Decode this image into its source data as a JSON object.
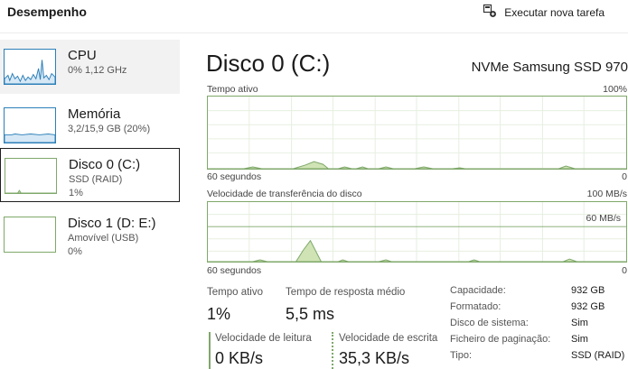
{
  "header": {
    "title": "Desempenho",
    "new_task_label": "Executar nova tarefa"
  },
  "sidebar": {
    "items": [
      {
        "name": "CPU",
        "line1": "0%  1,12 GHz",
        "line2": "",
        "state": "hover"
      },
      {
        "name": "Memória",
        "line1": "3,2/15,9 GB (20%)",
        "line2": "",
        "state": "normal"
      },
      {
        "name": "Disco 0 (C:)",
        "line1": "SSD (RAID)",
        "line2": "1%",
        "state": "selected"
      },
      {
        "name": "Disco 1 (D: E:)",
        "line1": "Amovível (USB)",
        "line2": "0%",
        "state": "normal"
      }
    ]
  },
  "main": {
    "title": "Disco 0 (C:)",
    "device": "NVMe Samsung SSD 970",
    "graph1": {
      "label": "Tempo ativo",
      "max_label": "100%",
      "time_label": "60 segundos",
      "min_label": "0"
    },
    "graph2": {
      "label": "Velocidade de transferência do disco",
      "max_label": "100 MB/s",
      "scale_label": "60 MB/s",
      "time_label": "60 segundos",
      "min_label": "0"
    },
    "stats": {
      "active_time_label": "Tempo ativo",
      "active_time_value": "1%",
      "response_label": "Tempo de resposta médio",
      "response_value": "5,5 ms",
      "read_label": "Velocidade de leitura",
      "read_value": "0 KB/s",
      "write_label": "Velocidade de escrita",
      "write_value": "35,3 KB/s"
    },
    "properties": [
      {
        "key": "Capacidade:",
        "value": "932 GB"
      },
      {
        "key": "Formatado:",
        "value": "932 GB"
      },
      {
        "key": "Disco de sistema:",
        "value": "Sim"
      },
      {
        "key": "Ficheiro de paginação:",
        "value": "Sim"
      },
      {
        "key": "Tipo:",
        "value": "SSD (RAID)"
      }
    ]
  },
  "colors": {
    "graph_border": "#7fa86a",
    "graph_fill": "#cfe3b4",
    "grid": "#e6efe0",
    "cpu_accent": "#2c7fb8",
    "selected_border": "#1f1f1f"
  },
  "icons": {
    "new_task": "new-task-icon"
  }
}
